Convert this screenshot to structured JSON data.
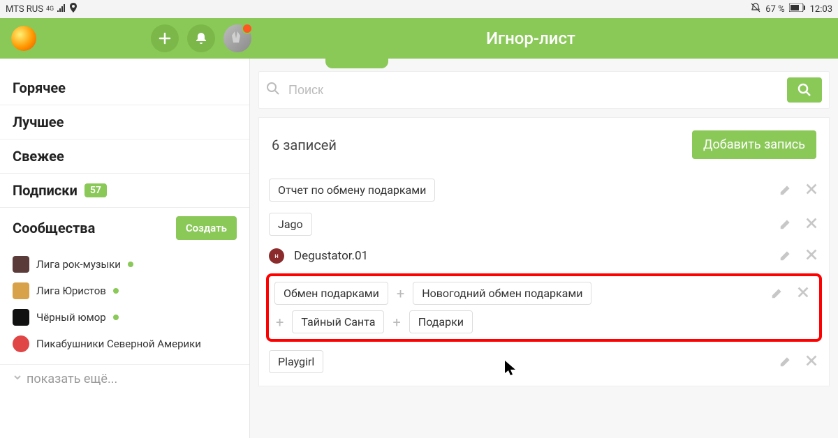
{
  "status": {
    "carrier": "MTS RUS",
    "net": "4G",
    "battery": "67 %",
    "time": "12:03"
  },
  "header": {
    "title": "Игнор-лист"
  },
  "sidebar": {
    "hot": "Горячее",
    "best": "Лучшее",
    "fresh": "Свежее",
    "subs": "Подписки",
    "subs_count": "57",
    "communities": "Сообщества",
    "create": "Создать",
    "list": [
      {
        "label": "Лига рок-музыки",
        "online": true,
        "color": "#5b3a3a"
      },
      {
        "label": "Лига Юристов",
        "online": true,
        "color": "#d8a24a"
      },
      {
        "label": "Чёрный юмор",
        "online": true,
        "color": "#111"
      },
      {
        "label": "Пикабушники Северной Америки",
        "online": false,
        "color": "#e04646"
      }
    ],
    "show_more": "показать ещё..."
  },
  "search": {
    "placeholder": "Поиск"
  },
  "records": {
    "count_label": "6 записей",
    "add_label": "Добавить запись"
  },
  "entries": {
    "e1": "Отчет по обмену подарками",
    "e2": "Jago",
    "e3": "Degustator.01",
    "e4a": "Обмен подарками",
    "e4b": "Новогодний обмен подарками",
    "e4c": "Тайный Санта",
    "e4d": "Подарки",
    "e5": "Playgirl"
  }
}
